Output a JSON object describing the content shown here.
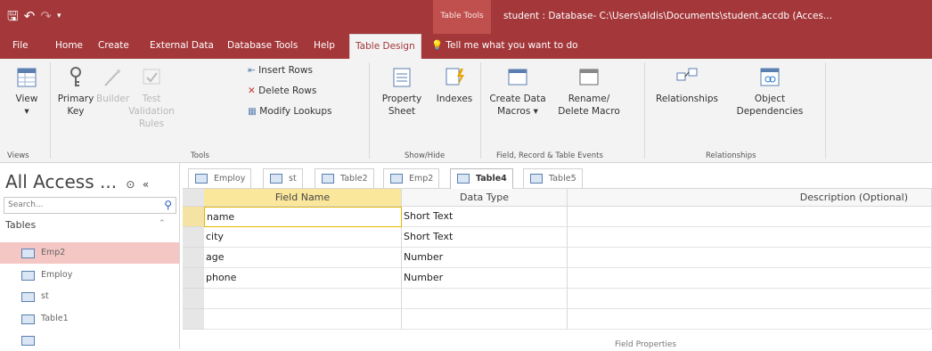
{
  "titlebar": {
    "contextual_label": "Table Tools",
    "title": "student : Database- C:\\Users\\aldis\\Documents\\student.accdb (Acces..."
  },
  "ribbon_tabs": [
    {
      "label": "File"
    },
    {
      "label": "Home"
    },
    {
      "label": "Create"
    },
    {
      "label": "External Data"
    },
    {
      "label": "Database Tools"
    },
    {
      "label": "Help"
    },
    {
      "label": "Table Design"
    }
  ],
  "tellme": "Tell me what you want to do",
  "ribbon": {
    "view": "View",
    "views_group": "Views",
    "primary_key": "Primary Key",
    "builder": "Builder",
    "test_validation_rules": "Test Validation Rules",
    "insert_rows": "Insert Rows",
    "delete_rows": "Delete Rows",
    "modify_lookups": "Modify Lookups",
    "tools_group": "Tools",
    "property_sheet": "Property Sheet",
    "indexes": "Indexes",
    "showhide_group": "Show/Hide",
    "create_data_macros": "Create Data Macros",
    "rename_delete_macro": "Rename/ Delete Macro",
    "field_events_group": "Field, Record & Table Events",
    "relationships": "Relationships",
    "object_dependencies": "Object Dependencies",
    "relationships_group": "Relationships"
  },
  "nav": {
    "title": "All Access ...",
    "search_placeholder": "Search...",
    "section": "Tables",
    "items": [
      {
        "label": "Emp2",
        "selected": true
      },
      {
        "label": "Employ"
      },
      {
        "label": "st"
      },
      {
        "label": "Table1"
      }
    ]
  },
  "doc_tabs": [
    {
      "label": "Employ"
    },
    {
      "label": "st"
    },
    {
      "label": "Table2"
    },
    {
      "label": "Emp2"
    },
    {
      "label": "Table4",
      "active": true
    },
    {
      "label": "Table5"
    }
  ],
  "grid": {
    "headers": [
      "Field Name",
      "Data Type",
      "Description (Optional)"
    ],
    "rows": [
      {
        "field": "name",
        "type": "Short Text"
      },
      {
        "field": "city",
        "type": "Short Text"
      },
      {
        "field": "age",
        "type": "Number"
      },
      {
        "field": "phone",
        "type": "Number"
      }
    ]
  },
  "field_properties_label": "Field Properties",
  "colors": {
    "accent": "#a4373a",
    "nav_selected": "#f4c7c4",
    "header_highlight": "#fbe79b"
  }
}
